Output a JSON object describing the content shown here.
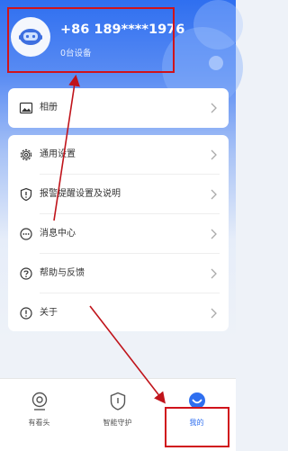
{
  "profile": {
    "phone": "+86 189****1976",
    "device_count": "0台设备"
  },
  "menu": {
    "album": "相册",
    "items": [
      {
        "label": "通用设置",
        "icon": "gear-icon"
      },
      {
        "label": "报警提醒设置及说明",
        "icon": "shield-alert-icon"
      },
      {
        "label": "消息中心",
        "icon": "chat-dots-icon"
      },
      {
        "label": "帮助与反馈",
        "icon": "help-circle-icon"
      },
      {
        "label": "关于",
        "icon": "info-circle-icon"
      }
    ]
  },
  "tabbar": {
    "tabs": [
      {
        "label": "有看头",
        "icon": "camera-icon"
      },
      {
        "label": "智能守护",
        "icon": "shield-guard-icon"
      },
      {
        "label": "我的",
        "icon": "profile-smile-icon",
        "active": true
      }
    ]
  },
  "colors": {
    "accent": "#2f6ff0",
    "annotation": "#d0131b"
  }
}
